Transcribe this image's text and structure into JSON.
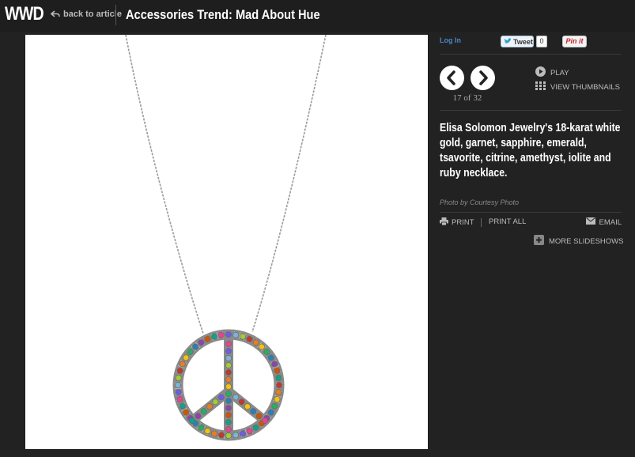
{
  "header": {
    "logo": "WWD",
    "back_label": "back to article",
    "title": "Accessories Trend: Mad About Hue"
  },
  "social": {
    "login_label": "Log In",
    "tweet_label": "Tweet",
    "tweet_count": "0",
    "pin_label": "Pin it"
  },
  "slideshow": {
    "counter": "17 of 32",
    "play_label": "PLAY",
    "thumbnails_label": "VIEW THUMBNAILS"
  },
  "caption": "Elisa Solomon Jewelry's 18-karat white gold, garnet, sapphire, emerald, tsavorite, citrine, amethyst, iolite and ruby necklace.",
  "credit": "Photo by Courtesy Photo",
  "actions": {
    "print_label": "PRINT",
    "print_all_label": "PRINT ALL",
    "email_label": "EMAIL",
    "more_label": "MORE SLIDESHOWS"
  },
  "colors": {
    "background": "#222222",
    "link_blue": "#4e86c6",
    "pin_red": "#c8232c"
  }
}
